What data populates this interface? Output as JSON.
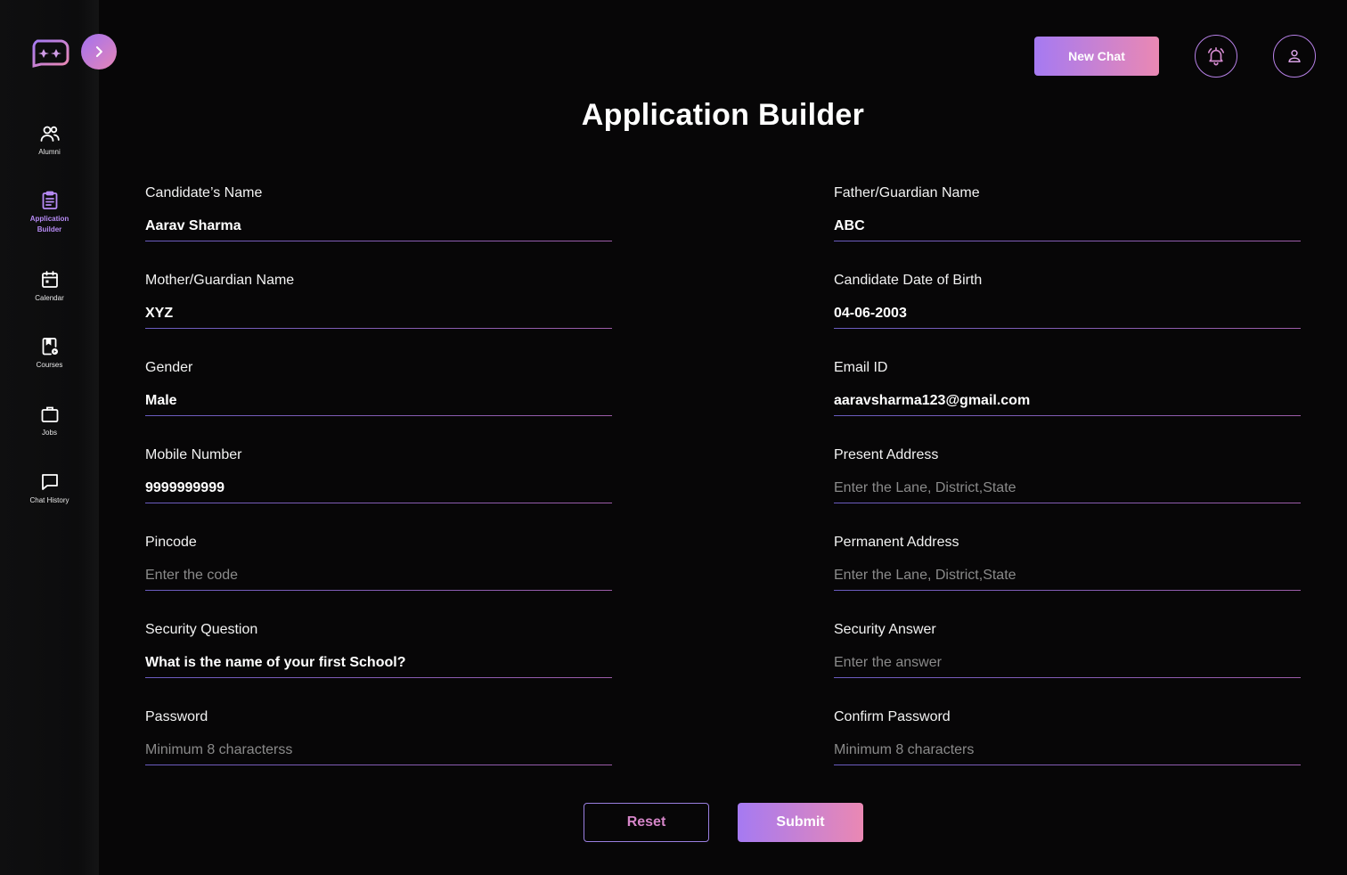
{
  "sidebar": {
    "items": [
      {
        "label": "Alumni",
        "icon": "users-icon"
      },
      {
        "label": "Application Builder",
        "icon": "clipboard-icon",
        "active": true
      },
      {
        "label": "Calendar",
        "icon": "calendar-icon"
      },
      {
        "label": "Courses",
        "icon": "courses-icon"
      },
      {
        "label": "Jobs",
        "icon": "briefcase-icon"
      },
      {
        "label": "Chat History",
        "icon": "chat-icon"
      }
    ]
  },
  "header": {
    "new_chat_label": "New Chat",
    "accent_gradient": [
      "#a57af2",
      "#ea88b3"
    ]
  },
  "page": {
    "title": "Application Builder"
  },
  "form": {
    "candidate_name": {
      "label": "Candidate’s Name",
      "value": "Aarav Sharma",
      "placeholder": ""
    },
    "father_name": {
      "label": "Father/Guardian Name",
      "value": "ABC",
      "placeholder": ""
    },
    "mother_name": {
      "label": "Mother/Guardian Name",
      "value": "XYZ",
      "placeholder": ""
    },
    "dob": {
      "label": "Candidate Date of Birth",
      "value": "04-06-2003",
      "placeholder": ""
    },
    "gender": {
      "label": "Gender",
      "value": "Male",
      "placeholder": ""
    },
    "email": {
      "label": "Email ID",
      "value": "aaravsharma123@gmail.com",
      "placeholder": ""
    },
    "mobile": {
      "label": "Mobile Number",
      "value": "9999999999",
      "placeholder": ""
    },
    "present_address": {
      "label": "Present Address",
      "value": "",
      "placeholder": "Enter the Lane, District,State"
    },
    "pincode": {
      "label": "Pincode",
      "value": "",
      "placeholder": "Enter the code"
    },
    "permanent_address": {
      "label": "Permanent Address",
      "value": "",
      "placeholder": "Enter the Lane, District,State"
    },
    "security_question": {
      "label": "Security Question",
      "value": "What is the name of your first School?",
      "placeholder": ""
    },
    "security_answer": {
      "label": "Security Answer",
      "value": "",
      "placeholder": "Enter the answer"
    },
    "password": {
      "label": "Password",
      "value": "",
      "placeholder": "Minimum 8 characterss"
    },
    "confirm_password": {
      "label": "Confirm Password",
      "value": "",
      "placeholder": "Minimum 8 characters"
    }
  },
  "actions": {
    "reset_label": "Reset",
    "submit_label": "Submit"
  }
}
